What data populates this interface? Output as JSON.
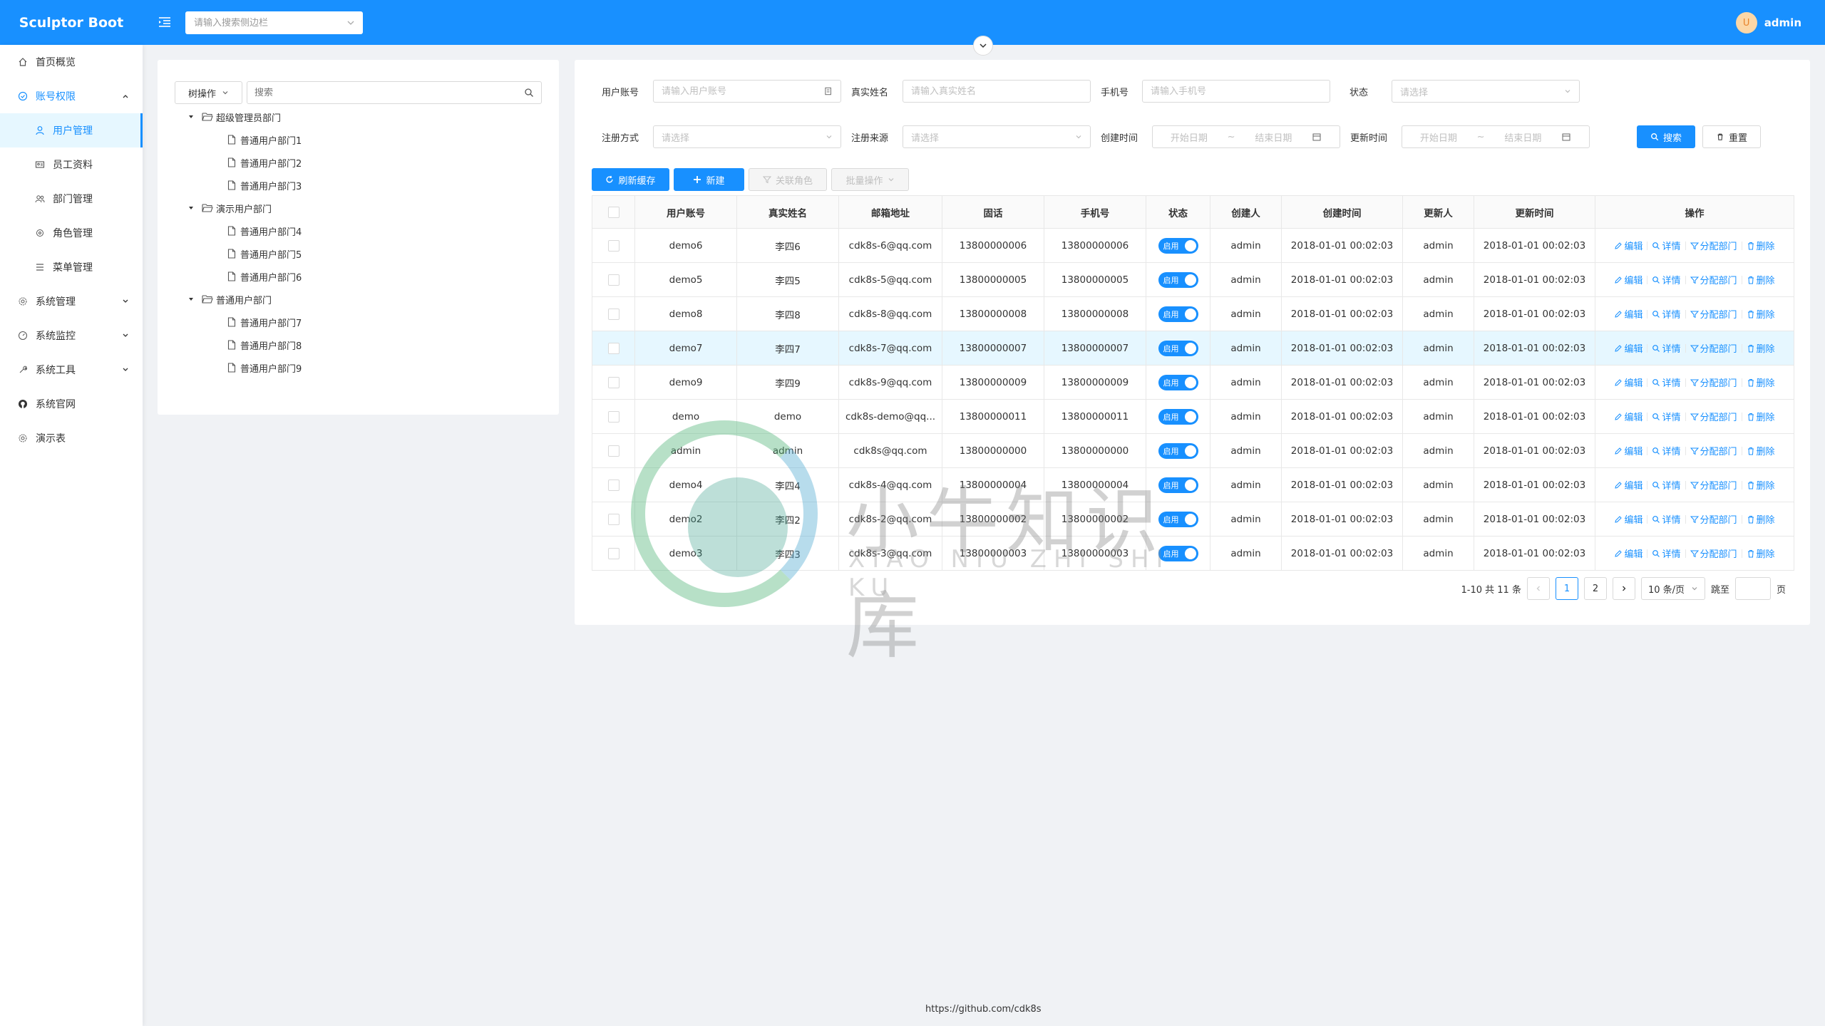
{
  "app": {
    "title": "Sculptor Boot",
    "user": "admin",
    "avatar_letter": "U"
  },
  "header": {
    "menu_search_placeholder": "请输入搜索侧边栏"
  },
  "sidebar": {
    "items": [
      {
        "label": "首页概览",
        "icon": "home-icon"
      },
      {
        "label": "账号权限",
        "icon": "security-icon"
      },
      {
        "label": "用户管理",
        "icon": "user-icon"
      },
      {
        "label": "员工资料",
        "icon": "idcard-icon"
      },
      {
        "label": "部门管理",
        "icon": "team-icon"
      },
      {
        "label": "角色管理",
        "icon": "role-icon"
      },
      {
        "label": "菜单管理",
        "icon": "menu-icon"
      },
      {
        "label": "系统管理",
        "icon": "setting-icon"
      },
      {
        "label": "系统监控",
        "icon": "dashboard-icon"
      },
      {
        "label": "系统工具",
        "icon": "tool-icon"
      },
      {
        "label": "系统官网",
        "icon": "github-icon"
      },
      {
        "label": "演示表",
        "icon": "setting-icon"
      }
    ]
  },
  "tree": {
    "op_label": "树操作",
    "search_placeholder": "搜索",
    "nodes": [
      {
        "label": "超级管理员部门",
        "level": 0
      },
      {
        "label": "普通用户部门1",
        "level": 1
      },
      {
        "label": "普通用户部门2",
        "level": 1
      },
      {
        "label": "普通用户部门3",
        "level": 1
      },
      {
        "label": "演示用户部门",
        "level": 0
      },
      {
        "label": "普通用户部门4",
        "level": 1
      },
      {
        "label": "普通用户部门5",
        "level": 1
      },
      {
        "label": "普通用户部门6",
        "level": 1
      },
      {
        "label": "普通用户部门",
        "level": 0
      },
      {
        "label": "普通用户部门7",
        "level": 1
      },
      {
        "label": "普通用户部门8",
        "level": 1
      },
      {
        "label": "普通用户部门9",
        "level": 1
      }
    ]
  },
  "filters": {
    "account_label": "用户账号",
    "account_placeholder": "请输入用户账号",
    "name_label": "真实姓名",
    "name_placeholder": "请输入真实姓名",
    "phone_label": "手机号",
    "phone_placeholder": "请输入手机号",
    "status_label": "状态",
    "status_placeholder": "请选择",
    "reg_way_label": "注册方式",
    "reg_way_placeholder": "请选择",
    "reg_src_label": "注册来源",
    "reg_src_placeholder": "请选择",
    "create_label": "创建时间",
    "update_label": "更新时间",
    "start_date": "开始日期",
    "end_date": "结束日期",
    "tilde": "~",
    "search_btn": "搜索",
    "reset_btn": "重置"
  },
  "toolbar": {
    "refresh": "刷新缓存",
    "new": "新建",
    "link_role": "关联角色",
    "batch": "批量操作"
  },
  "table": {
    "headers": [
      "用户账号",
      "真实姓名",
      "邮箱地址",
      "固话",
      "手机号",
      "状态",
      "创建人",
      "创建时间",
      "更新人",
      "更新时间",
      "操作"
    ],
    "status_text": "启用",
    "ops": [
      "编辑",
      "详情",
      "分配部门",
      "删除"
    ],
    "rows": [
      {
        "account": "demo6",
        "name": "李四6",
        "email": "cdk8s-6@qq.com",
        "tel": "13800000006",
        "mobile": "13800000006",
        "creator": "admin",
        "created": "2018-01-01 00:02:03",
        "updater": "admin",
        "updated": "2018-01-01 00:02:03"
      },
      {
        "account": "demo5",
        "name": "李四5",
        "email": "cdk8s-5@qq.com",
        "tel": "13800000005",
        "mobile": "13800000005",
        "creator": "admin",
        "created": "2018-01-01 00:02:03",
        "updater": "admin",
        "updated": "2018-01-01 00:02:03"
      },
      {
        "account": "demo8",
        "name": "李四8",
        "email": "cdk8s-8@qq.com",
        "tel": "13800000008",
        "mobile": "13800000008",
        "creator": "admin",
        "created": "2018-01-01 00:02:03",
        "updater": "admin",
        "updated": "2018-01-01 00:02:03"
      },
      {
        "account": "demo7",
        "name": "李四7",
        "email": "cdk8s-7@qq.com",
        "tel": "13800000007",
        "mobile": "13800000007",
        "creator": "admin",
        "created": "2018-01-01 00:02:03",
        "updater": "admin",
        "updated": "2018-01-01 00:02:03"
      },
      {
        "account": "demo9",
        "name": "李四9",
        "email": "cdk8s-9@qq.com",
        "tel": "13800000009",
        "mobile": "13800000009",
        "creator": "admin",
        "created": "2018-01-01 00:02:03",
        "updater": "admin",
        "updated": "2018-01-01 00:02:03"
      },
      {
        "account": "demo",
        "name": "demo",
        "email": "cdk8s-demo@qq...",
        "tel": "13800000011",
        "mobile": "13800000011",
        "creator": "admin",
        "created": "2018-01-01 00:02:03",
        "updater": "admin",
        "updated": "2018-01-01 00:02:03"
      },
      {
        "account": "admin",
        "name": "admin",
        "email": "cdk8s@qq.com",
        "tel": "13800000000",
        "mobile": "13800000000",
        "creator": "admin",
        "created": "2018-01-01 00:02:03",
        "updater": "admin",
        "updated": "2018-01-01 00:02:03"
      },
      {
        "account": "demo4",
        "name": "李四4",
        "email": "cdk8s-4@qq.com",
        "tel": "13800000004",
        "mobile": "13800000004",
        "creator": "admin",
        "created": "2018-01-01 00:02:03",
        "updater": "admin",
        "updated": "2018-01-01 00:02:03"
      },
      {
        "account": "demo2",
        "name": "李四2",
        "email": "cdk8s-2@qq.com",
        "tel": "13800000002",
        "mobile": "13800000002",
        "creator": "admin",
        "created": "2018-01-01 00:02:03",
        "updater": "admin",
        "updated": "2018-01-01 00:02:03"
      },
      {
        "account": "demo3",
        "name": "李四3",
        "email": "cdk8s-3@qq.com",
        "tel": "13800000003",
        "mobile": "13800000003",
        "creator": "admin",
        "created": "2018-01-01 00:02:03",
        "updater": "admin",
        "updated": "2018-01-01 00:02:03"
      }
    ]
  },
  "pagination": {
    "summary": "1-10 共 11 条",
    "pages": [
      "1",
      "2"
    ],
    "page_size": "10 条/页",
    "jump_label": "跳至",
    "jump_suffix": "页"
  },
  "footer": {
    "text": "https://github.com/cdk8s"
  },
  "watermark": {
    "text": "小牛知识库",
    "sub": "XIAO NIU ZHI SHI KU"
  },
  "colors": {
    "primary": "#1890ff",
    "highlight_row": "#e6f7ff"
  }
}
